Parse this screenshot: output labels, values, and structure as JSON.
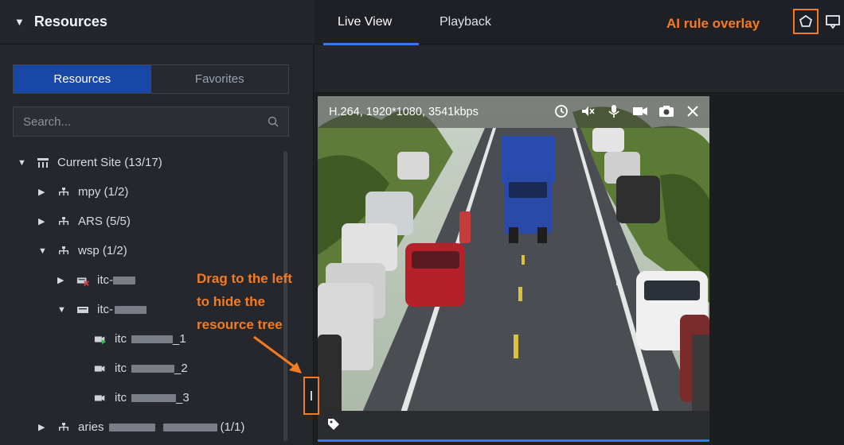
{
  "left_panel": {
    "header_title": "Resources",
    "toggle": {
      "resources": "Resources",
      "favorites": "Favorites"
    },
    "search": {
      "placeholder": "Search..."
    }
  },
  "tree": {
    "site": "Current Site (13/17)",
    "items": [
      {
        "label": "mpy (1/2)"
      },
      {
        "label": "ARS (5/5)"
      },
      {
        "label": "wsp (1/2)"
      }
    ],
    "devices": [
      {
        "prefix": "itc-"
      },
      {
        "prefix": "itc-"
      }
    ],
    "channels": [
      {
        "prefix": "itc",
        "suffix": "_1"
      },
      {
        "prefix": "itc",
        "suffix": "_2"
      },
      {
        "prefix": "itc",
        "suffix": "_3"
      }
    ],
    "last": {
      "prefix": "aries",
      "suffix": "(1/1)"
    }
  },
  "tabs": {
    "live_view": "Live View",
    "playback": "Playback"
  },
  "annotations": {
    "ai_rule": "AI rule overlay",
    "drag_line1": "Drag to the left",
    "drag_line2": "to hide the",
    "drag_line3": "resource tree"
  },
  "video": {
    "stream_info": "H.264, 1920*1080, 3541kbps",
    "controls": [
      "replay-icon",
      "mute-icon",
      "microphone-icon",
      "record-icon",
      "snapshot-icon",
      "close-icon"
    ]
  },
  "colors": {
    "accent": "#1847a8",
    "annotation": "#f47c20",
    "tab_underline": "#2f7bf2"
  }
}
